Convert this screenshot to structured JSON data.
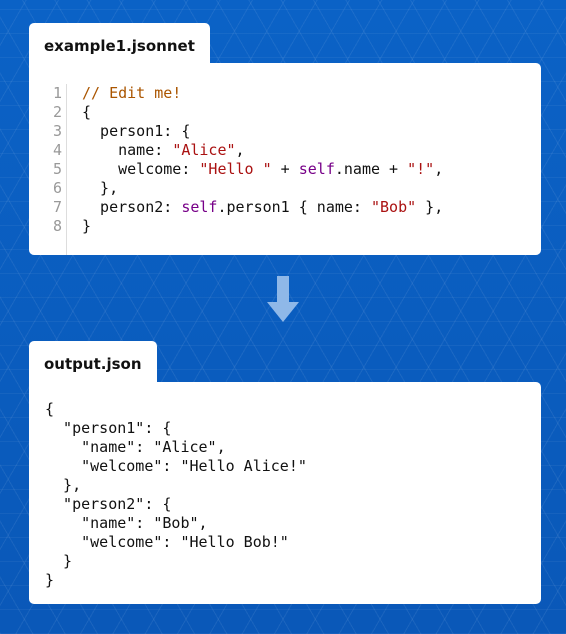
{
  "input_tab": {
    "label": "example1.jsonnet"
  },
  "output_tab": {
    "label": "output.json"
  },
  "colors": {
    "background": "#0a5cc0",
    "comment": "#aa5500",
    "string": "#aa1111",
    "keyword": "#770088",
    "arrow": "#8fb8e8"
  },
  "icons": {
    "transform_arrow": "down-arrow-icon"
  },
  "editor": {
    "line_numbers": [
      "1",
      "2",
      "3",
      "4",
      "5",
      "6",
      "7",
      "8"
    ],
    "lines": [
      [
        {
          "t": "// Edit me!",
          "k": "comment"
        }
      ],
      [
        {
          "t": "{",
          "k": "plain"
        }
      ],
      [
        {
          "t": "  person1: {",
          "k": "plain"
        }
      ],
      [
        {
          "t": "    name: ",
          "k": "plain"
        },
        {
          "t": "\"Alice\"",
          "k": "string"
        },
        {
          "t": ",",
          "k": "plain"
        }
      ],
      [
        {
          "t": "    welcome: ",
          "k": "plain"
        },
        {
          "t": "\"Hello \"",
          "k": "string"
        },
        {
          "t": " + ",
          "k": "plain"
        },
        {
          "t": "self",
          "k": "keyword"
        },
        {
          "t": ".name + ",
          "k": "plain"
        },
        {
          "t": "\"!\"",
          "k": "string"
        },
        {
          "t": ",",
          "k": "plain"
        }
      ],
      [
        {
          "t": "  },",
          "k": "plain"
        }
      ],
      [
        {
          "t": "  person2: ",
          "k": "plain"
        },
        {
          "t": "self",
          "k": "keyword"
        },
        {
          "t": ".person1 { name: ",
          "k": "plain"
        },
        {
          "t": "\"Bob\"",
          "k": "string"
        },
        {
          "t": " },",
          "k": "plain"
        }
      ],
      [
        {
          "t": "}",
          "k": "plain"
        }
      ]
    ]
  },
  "output": {
    "lines": [
      "{",
      "  \"person1\": {",
      "    \"name\": \"Alice\",",
      "    \"welcome\": \"Hello Alice!\"",
      "  },",
      "  \"person2\": {",
      "    \"name\": \"Bob\",",
      "    \"welcome\": \"Hello Bob!\"",
      "  }",
      "}"
    ]
  }
}
